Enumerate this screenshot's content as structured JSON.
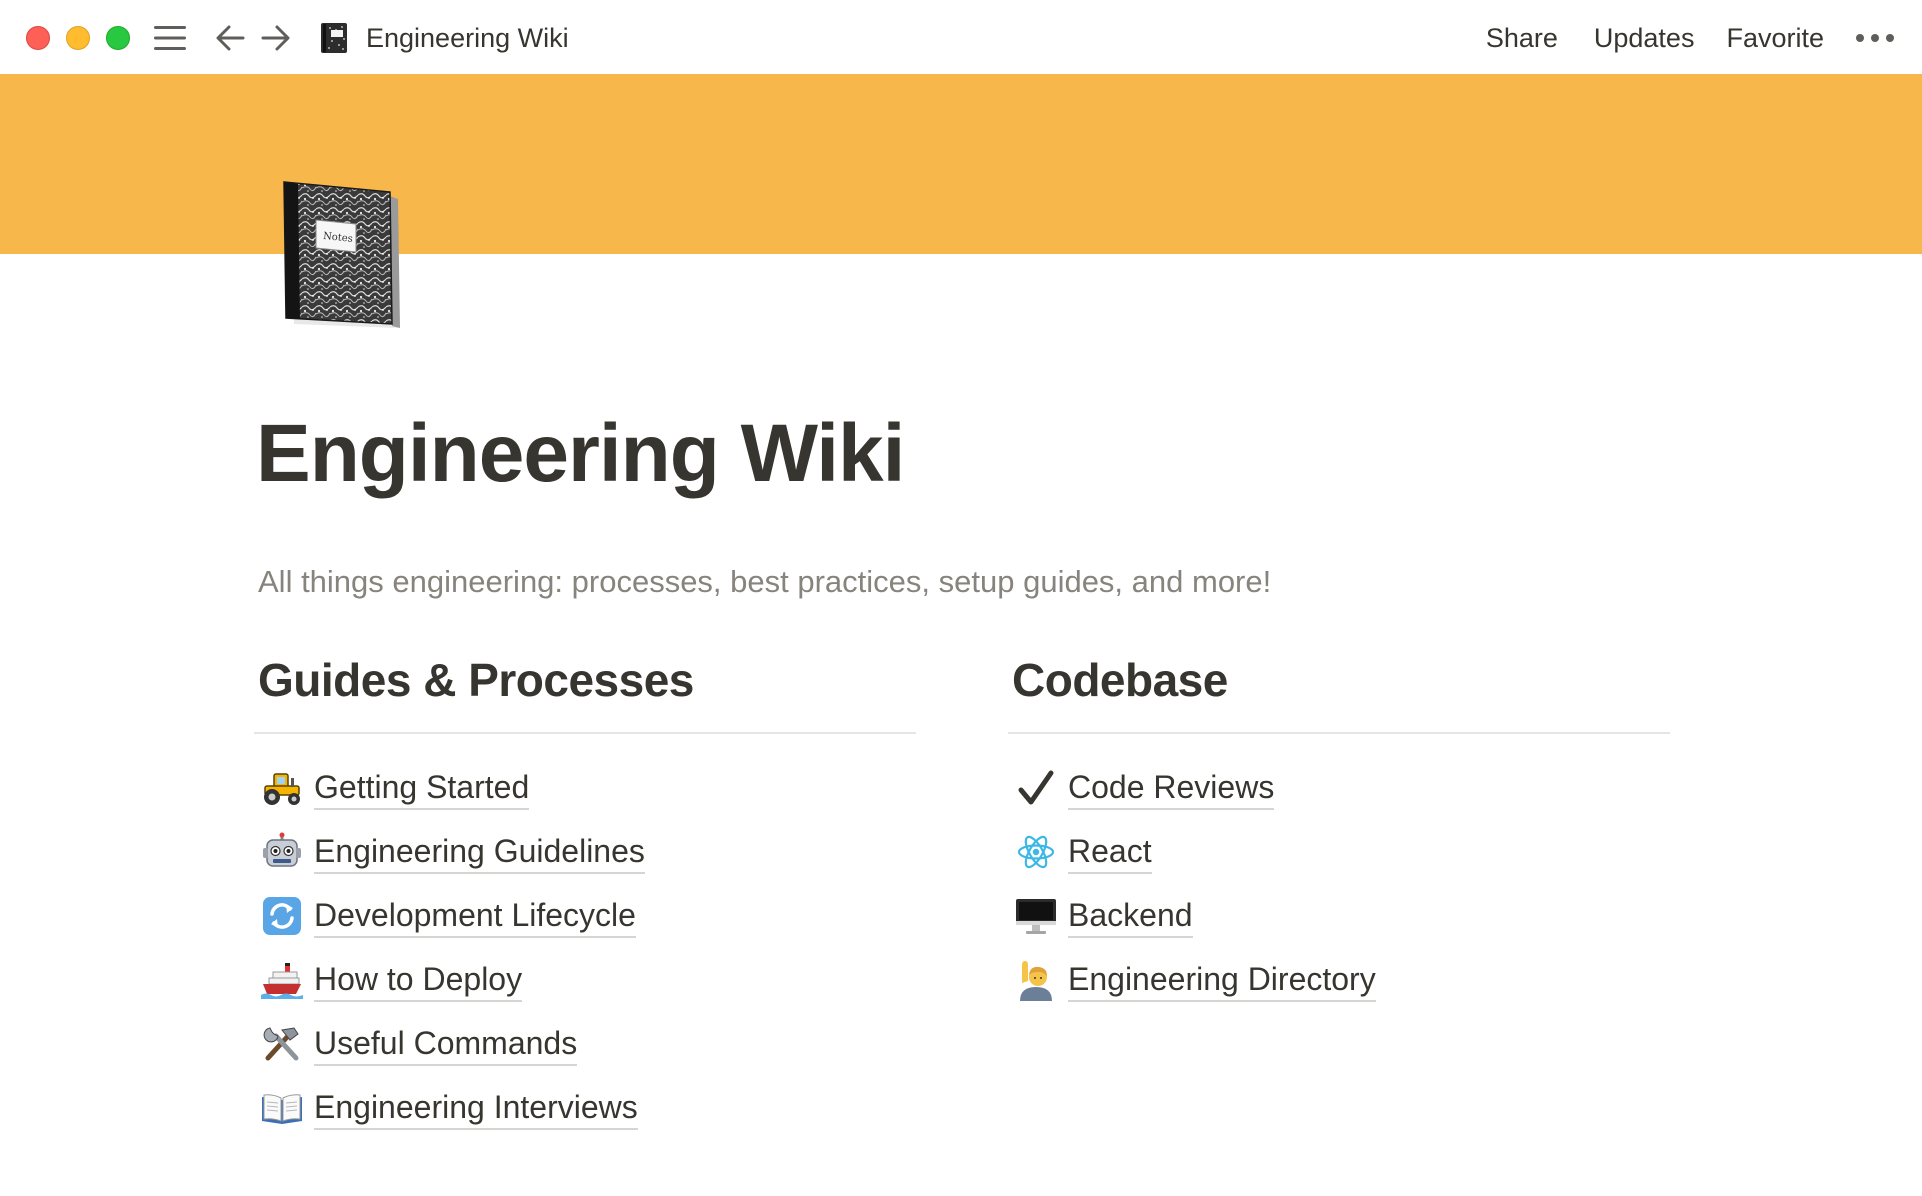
{
  "window": {
    "breadcrumb_title": "Engineering Wiki",
    "page_icon": "notebook-icon",
    "nav_icons": [
      "sidebar-menu-icon",
      "back-arrow-icon",
      "forward-arrow-icon"
    ],
    "traffic_lights": {
      "close": "#fe5f57",
      "minimize": "#febc2e",
      "zoom": "#28c840"
    }
  },
  "topbar": {
    "share_label": "Share",
    "updates_label": "Updates",
    "favorite_label": "Favorite",
    "more_icon": "more-dots-icon"
  },
  "page": {
    "cover_color": "#f8b74b",
    "title": "Engineering Wiki",
    "description": "All things engineering: processes, best practices, setup guides, and more!"
  },
  "columns": [
    {
      "heading": "Guides & Processes",
      "links": [
        {
          "icon": "tractor-icon",
          "label": "Getting Started"
        },
        {
          "icon": "robot-icon",
          "label": "Engineering Guidelines"
        },
        {
          "icon": "refresh-icon",
          "label": "Development Lifecycle"
        },
        {
          "icon": "ship-icon",
          "label": "How to Deploy"
        },
        {
          "icon": "tools-icon",
          "label": "Useful Commands"
        },
        {
          "icon": "open-book-icon",
          "label": "Engineering Interviews"
        }
      ]
    },
    {
      "heading": "Codebase",
      "links": [
        {
          "icon": "checkmark-icon",
          "label": "Code Reviews"
        },
        {
          "icon": "atom-icon",
          "label": "React"
        },
        {
          "icon": "desktop-computer-icon",
          "label": "Backend"
        },
        {
          "icon": "person-raising-hand-icon",
          "label": "Engineering Directory"
        }
      ]
    }
  ]
}
